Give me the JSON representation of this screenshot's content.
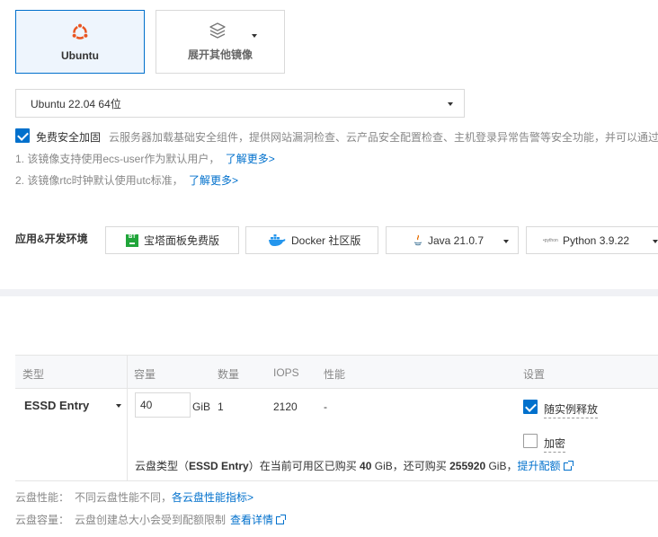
{
  "images": {
    "ubuntu_label": "Ubuntu",
    "more_label": "展开其他镜像"
  },
  "version_select": {
    "value": "Ubuntu 22.04 64位"
  },
  "security": {
    "checked": true,
    "label": "免费安全加固",
    "desc": "云服务器加载基础安全组件，提供网站漏洞检查、云产品安全配置检查、主机登录异常告警等安全功能，并可以通过"
  },
  "notes": [
    {
      "text": "1. 该镜像支持使用ecs-user作为默认用户，",
      "link": "了解更多>"
    },
    {
      "text": "2. 该镜像rtc时钟默认使用utc标准，",
      "link": "了解更多>"
    }
  ],
  "env": {
    "section_label": "应用&开发环境",
    "items": [
      {
        "label": "宝塔面板免费版",
        "icon": "bt-panel-icon"
      },
      {
        "label": "Docker 社区版",
        "icon": "docker-icon"
      },
      {
        "label": "Java 21.0.7",
        "icon": "java-icon"
      },
      {
        "label": "Python 3.9.22",
        "icon": "python-icon"
      }
    ]
  },
  "disk_table": {
    "headers": {
      "type": "类型",
      "capacity": "容量",
      "count": "数量",
      "iops": "IOPS",
      "performance": "性能",
      "settings": "设置"
    },
    "row": {
      "type": "ESSD Entry",
      "capacity": "40",
      "unit": "GiB",
      "count": "1",
      "iops": "2120",
      "performance": "-",
      "release_label": "随实例释放",
      "release_checked": true,
      "encrypt_label": "加密",
      "encrypt_checked": false
    },
    "quota": {
      "prefix": "云盘类型（",
      "type": "ESSD Entry",
      "mid1": "）在当前可用区已购买 ",
      "bought": "40",
      "mid2": " GiB，还可购买 ",
      "remaining": "255920",
      "mid3": " GiB，",
      "link": "提升配额"
    }
  },
  "footer": {
    "perf_label": "云盘性能：",
    "perf_text": "不同云盘性能不同，",
    "perf_link": "各云盘性能指标>",
    "cap_label": "云盘容量：",
    "cap_text": "云盘创建总大小会受到配额限制",
    "cap_link": "查看详情"
  },
  "colors": {
    "accent": "#0070cc",
    "ubuntu_orange": "#e95420"
  }
}
